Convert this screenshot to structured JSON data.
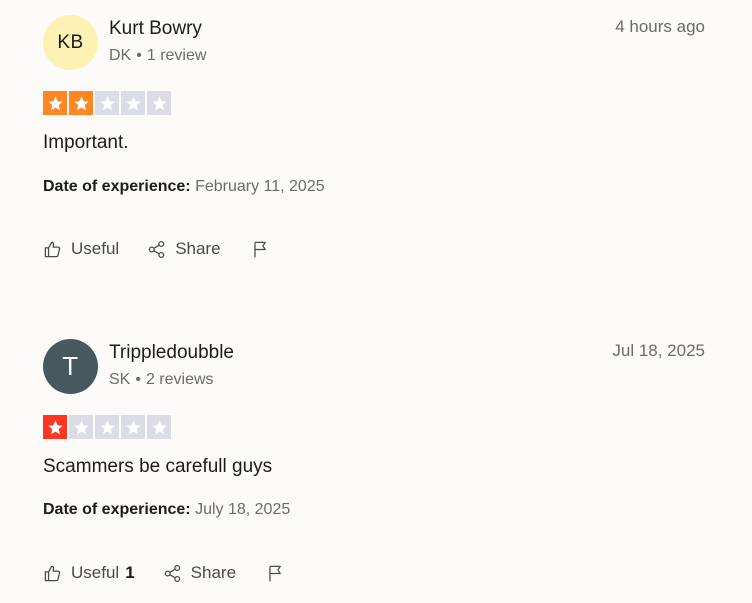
{
  "reviews": [
    {
      "avatar_initials": "KB",
      "avatar_bg": "#fdf1b4",
      "avatar_fg": "#1c1c1c",
      "name": "Kurt Bowry",
      "country": "DK",
      "review_count": "1 review",
      "posted": "4 hours ago",
      "rating": 2,
      "rating_color": "#ff8622",
      "text": "Important.",
      "experience_label": "Date of experience:",
      "experience_date": "February 11, 2025",
      "useful_label": "Useful",
      "useful_count": "",
      "share_label": "Share"
    },
    {
      "avatar_initials": "T",
      "avatar_bg": "#47595f",
      "avatar_fg": "#ffffff",
      "name": "Trippledoubble",
      "country": "SK",
      "review_count": "2 reviews",
      "posted": "Jul 18, 2025",
      "rating": 1,
      "rating_color": "#ff3722",
      "text": "Scammers be carefull guys",
      "experience_label": "Date of experience:",
      "experience_date": "July 18, 2025",
      "useful_label": "Useful",
      "useful_count": "1",
      "share_label": "Share"
    }
  ],
  "colors": {
    "empty_star": "#dcdce6"
  },
  "icons": {
    "useful": "thumbs-up-icon",
    "share": "share-icon",
    "report": "flag-icon",
    "star": "star-icon"
  }
}
